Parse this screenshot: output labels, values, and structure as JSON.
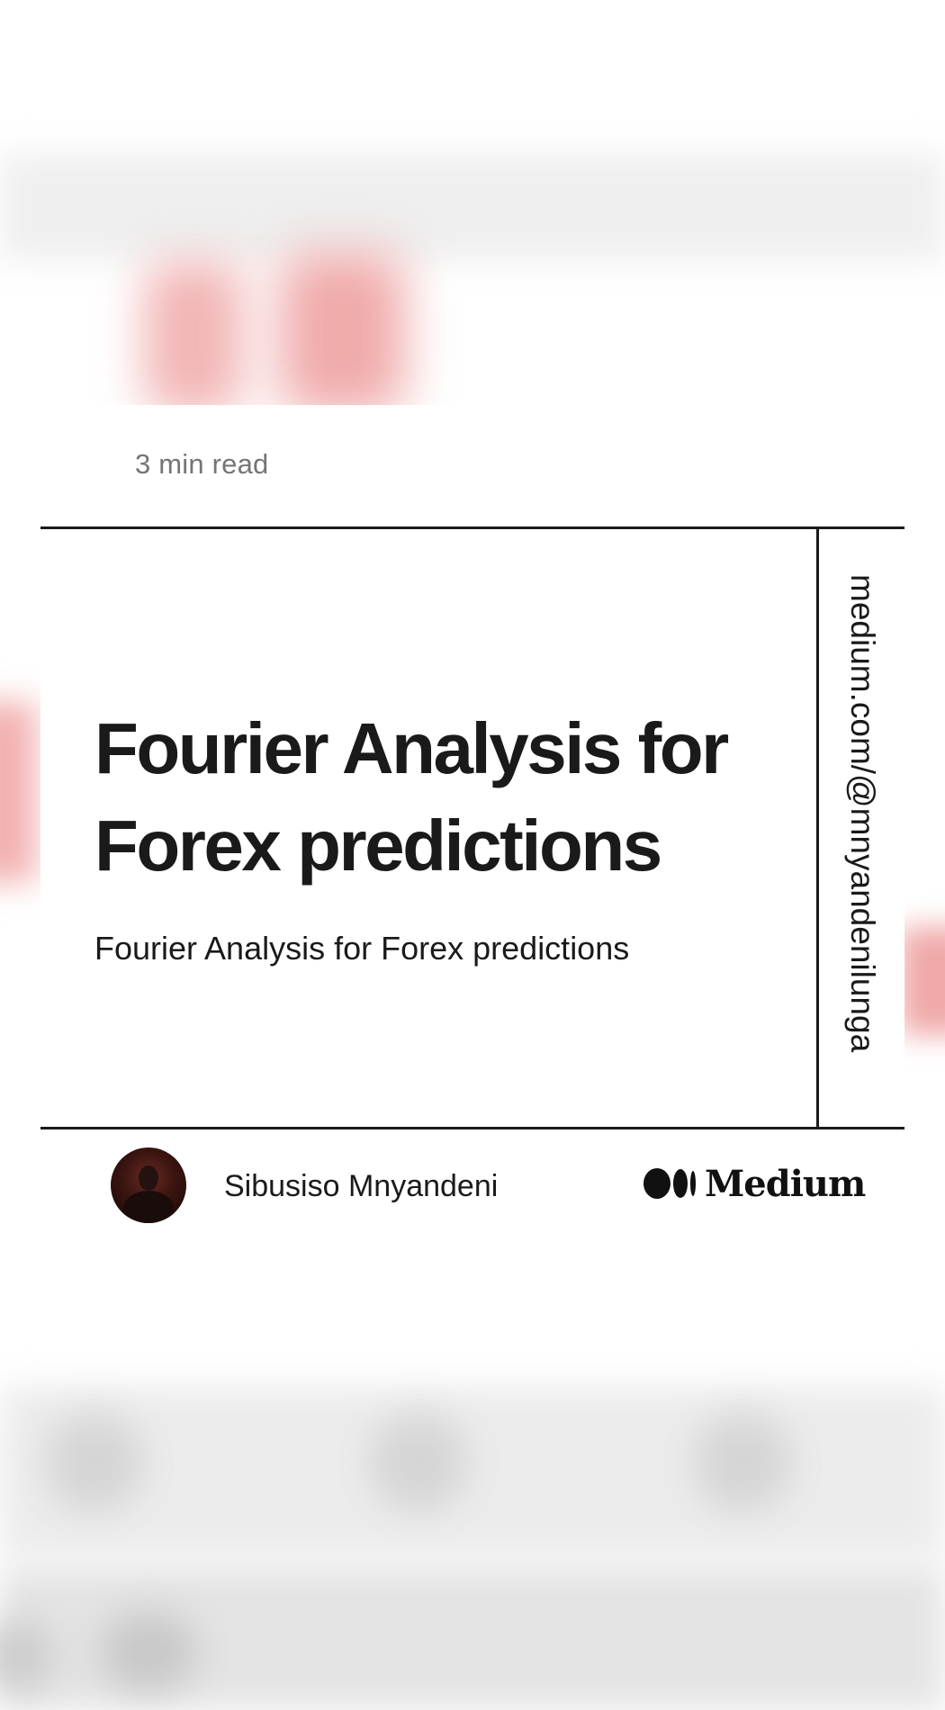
{
  "card": {
    "read_time": "3 min read",
    "headline": "Fourier Analysis for Forex predictions",
    "subtitle": "Fourier Analysis for Forex predictions",
    "side_url": "medium.com/@mnyandenilunga",
    "author_name": "Sibusiso Mnyandeni",
    "brand_name": "Medium"
  },
  "icons": {
    "avatar": "author-avatar",
    "logo": "medium-logo-icon"
  },
  "colors": {
    "text": "#1a1a1a",
    "muted": "#757575",
    "background": "#ffffff",
    "blurred_accent": "#f0aaaa"
  }
}
